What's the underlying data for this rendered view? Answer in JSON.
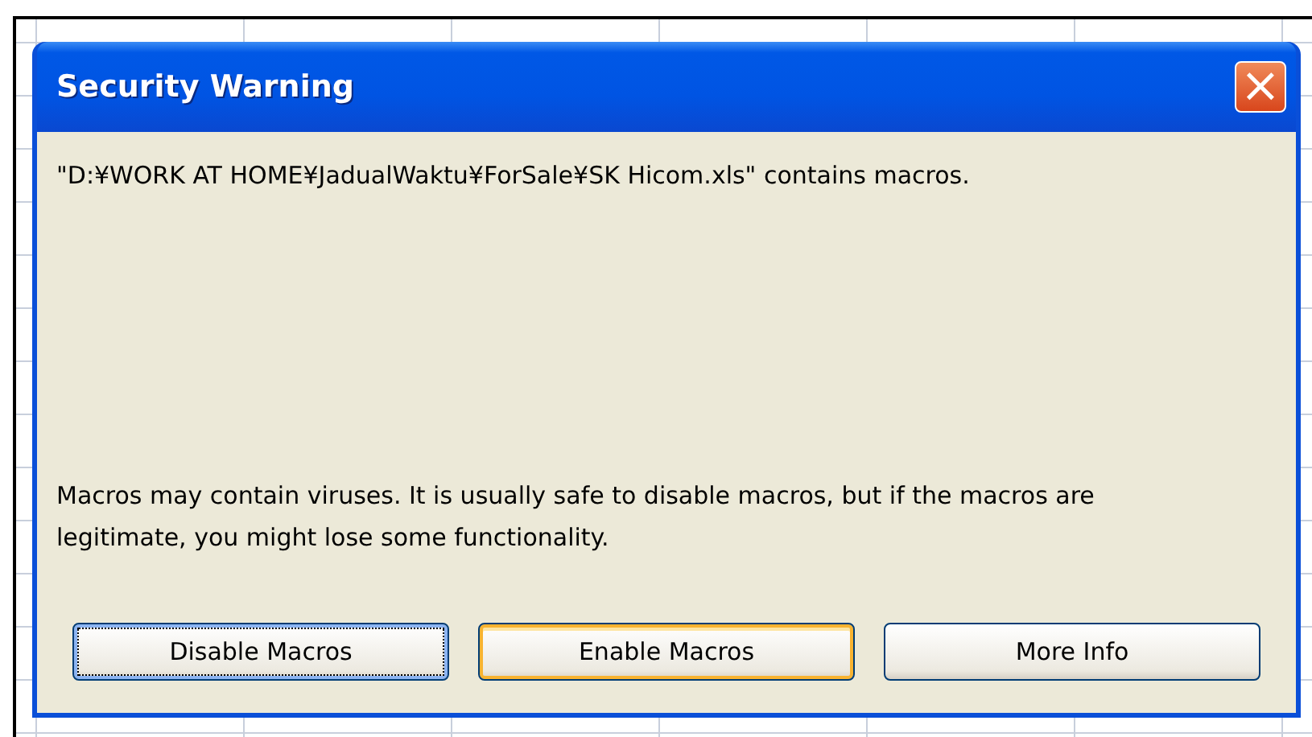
{
  "window": {
    "title": "Security Warning"
  },
  "close_button": {
    "label": "×"
  },
  "message": "\"D:¥WORK AT HOME¥JadualWaktu¥ForSale¥SK Hicom.xls\" contains macros.",
  "note": "Macros may contain viruses. It is usually safe to disable macros, but if the macros are legitimate, you might lose some functionality.",
  "buttons": [
    {
      "label": "Disable Macros",
      "focused": true,
      "hot": false
    },
    {
      "label": "Enable Macros",
      "focused": false,
      "hot": true
    },
    {
      "label": "More Info",
      "focused": false,
      "hot": false
    }
  ]
}
